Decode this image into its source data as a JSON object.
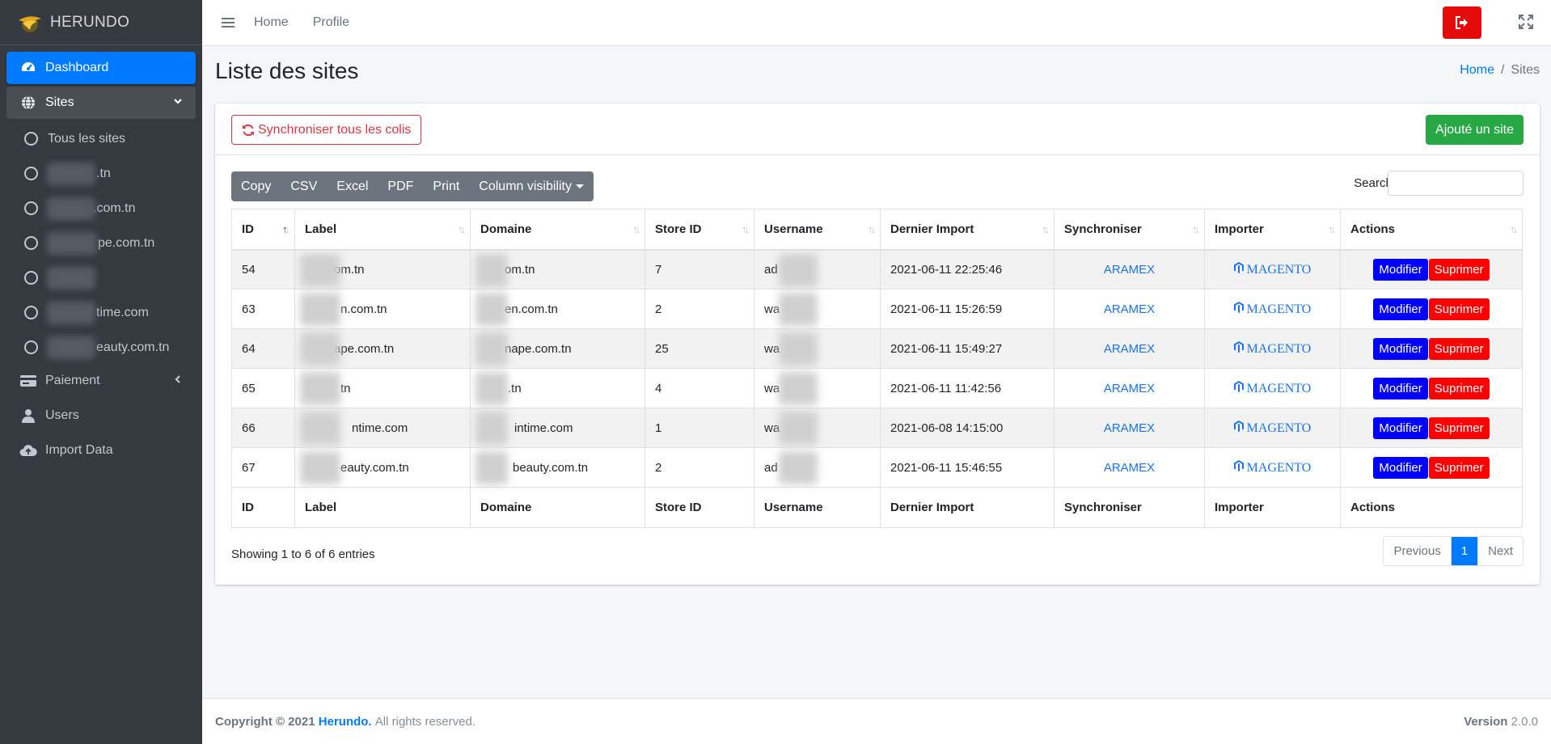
{
  "brand": {
    "name": "HERUNDO"
  },
  "sidebar": {
    "items": [
      {
        "label": "Dashboard",
        "icon": "dashboard-icon"
      },
      {
        "label": "Sites",
        "icon": "globe-icon"
      },
      {
        "label": "Paiement",
        "icon": "card-icon"
      },
      {
        "label": "Users",
        "icon": "user-icon"
      },
      {
        "label": "Import Data",
        "icon": "cloud-upload-icon"
      }
    ],
    "sub_items": [
      {
        "label": "Tous les sites"
      },
      {
        "label": ".tn"
      },
      {
        "label": ".com.tn"
      },
      {
        "label": "pe.com.tn"
      },
      {
        "label": ""
      },
      {
        "label": "time.com"
      },
      {
        "label": "eauty.com.tn"
      }
    ]
  },
  "topbar": {
    "home": "Home",
    "profile": "Profile"
  },
  "page": {
    "title": "Liste des sites"
  },
  "breadcrumb": {
    "home": "Home",
    "current": "Sites"
  },
  "card": {
    "sync_label": "Synchroniser tous les colis",
    "add_label": "Ajouté un site"
  },
  "toolbar": {
    "buttons": [
      "Copy",
      "CSV",
      "Excel",
      "PDF",
      "Print",
      "Column visibility"
    ]
  },
  "search": {
    "label": "Search:"
  },
  "table": {
    "columns": [
      "ID",
      "Label",
      "Domaine",
      "Store ID",
      "Username",
      "Dernier Import",
      "Synchroniser",
      "Importer",
      "Actions"
    ],
    "rows": [
      {
        "id": "54",
        "label": "om.tn",
        "domaine": "om.tn",
        "store": "7",
        "user": "ad",
        "date": "2021-06-11 22:25:46",
        "sync": "ARAMEX",
        "importer": "MAGENTO"
      },
      {
        "id": "63",
        "label": "n.com.tn",
        "domaine": "en.com.tn",
        "store": "2",
        "user": "wa",
        "date": "2021-06-11 15:26:59",
        "sync": "ARAMEX",
        "importer": "MAGENTO"
      },
      {
        "id": "64",
        "label": "ape.com.tn",
        "domaine": "nape.com.tn",
        "store": "25",
        "user": "wa",
        "date": "2021-06-11 15:49:27",
        "sync": "ARAMEX",
        "importer": "MAGENTO"
      },
      {
        "id": "65",
        "label": "tn",
        "domaine": ".tn",
        "store": "4",
        "user": "wa",
        "date": "2021-06-11 11:42:56",
        "sync": "ARAMEX",
        "importer": "MAGENTO"
      },
      {
        "id": "66",
        "label": "ntime.com",
        "domaine": "intime.com",
        "store": "1",
        "user": "wa",
        "date": "2021-06-08 14:15:00",
        "sync": "ARAMEX",
        "importer": "MAGENTO"
      },
      {
        "id": "67",
        "label": "eauty.com.tn",
        "domaine": "beauty.com.tn",
        "store": "2",
        "user": "ad",
        "date": "2021-06-11 15:46:55",
        "sync": "ARAMEX",
        "importer": "MAGENTO"
      }
    ],
    "actions": {
      "edit": "Modifier",
      "delete": "Suprimer"
    }
  },
  "pagination": {
    "info": "Showing 1 to 6 of 6 entries",
    "previous": "Previous",
    "current": "1",
    "next": "Next"
  },
  "footer": {
    "copyright": "Copyright © 2021",
    "company": "Herundo.",
    "rights": "All rights reserved.",
    "version_label": "Version",
    "version": "2.0.0"
  },
  "colors": {
    "sidebar_bg": "#343a40",
    "primary": "#007bff",
    "success": "#28a745",
    "danger": "#dc3545",
    "modify": "#0000ff",
    "delete": "#ff0000"
  }
}
